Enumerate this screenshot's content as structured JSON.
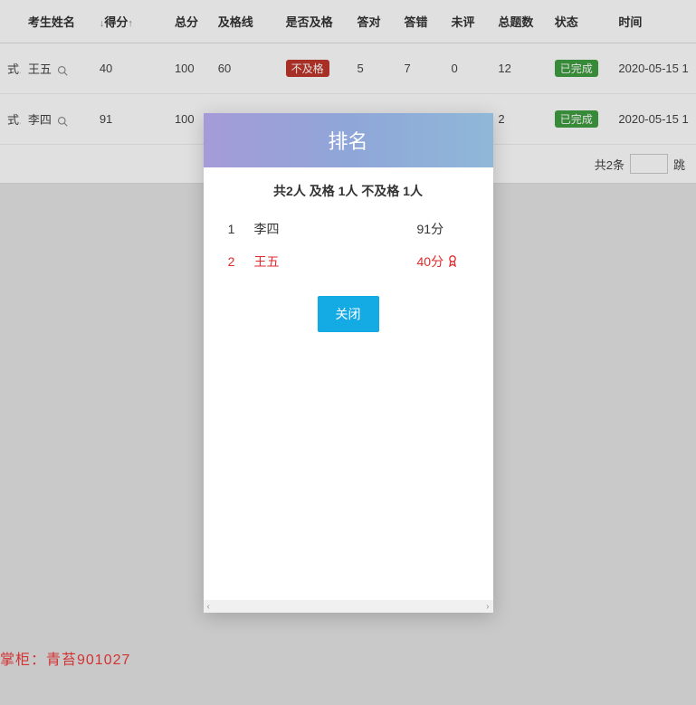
{
  "table": {
    "columns": {
      "name": "考生姓名",
      "score": "得分",
      "total": "总分",
      "passline": "及格线",
      "passflag": "是否及格",
      "correct": "答对",
      "wrong": "答错",
      "unrated": "未评",
      "count": "总题数",
      "status": "状态",
      "time": "时间"
    },
    "sort_down": "↓",
    "sort_up": "↑",
    "rows": [
      {
        "prefix": "式...",
        "name": "王五",
        "score": "40",
        "total": "100",
        "passline": "60",
        "passflag": "不及格",
        "correct": "5",
        "wrong": "7",
        "unrated": "0",
        "count": "12",
        "status": "已完成",
        "time": "2020-05-15 1"
      },
      {
        "prefix": "式...",
        "name": "李四",
        "score": "91",
        "total": "100",
        "passline": "",
        "passflag": "",
        "correct": "",
        "wrong": "",
        "unrated": "",
        "count": "2",
        "status": "已完成",
        "time": "2020-05-15 1"
      }
    ]
  },
  "pager": {
    "total_label": "共2条",
    "jump_label": "跳"
  },
  "modal": {
    "title": "排名",
    "summary": "共2人  及格 1人  不及格 1人",
    "rows": [
      {
        "idx": "1",
        "name": "李四",
        "score": "91分",
        "fail": false
      },
      {
        "idx": "2",
        "name": "王五",
        "score": "40分",
        "fail": true
      }
    ],
    "close": "关闭"
  },
  "footer": "掌柜：青苔901027"
}
